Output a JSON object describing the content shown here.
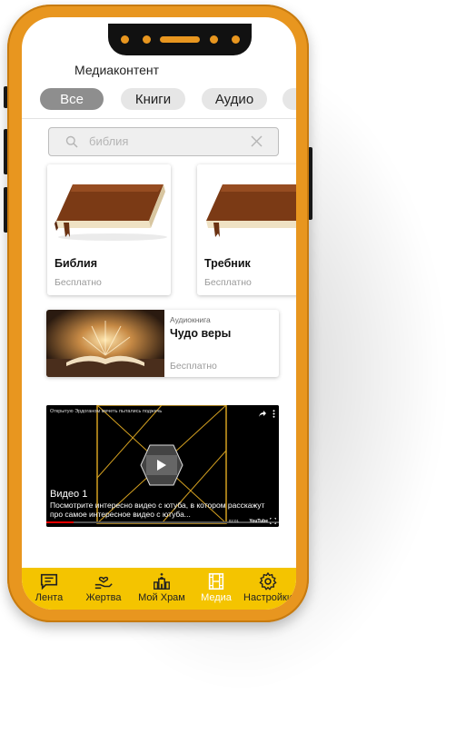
{
  "header": {
    "title": "Медиаконтент"
  },
  "filters": [
    {
      "label": "Все",
      "active": true
    },
    {
      "label": "Книги",
      "active": false
    },
    {
      "label": "Аудио",
      "active": false
    },
    {
      "label": "",
      "active": false
    }
  ],
  "search": {
    "value": "библия"
  },
  "books": [
    {
      "title": "Библия",
      "price": "Бесплатно"
    },
    {
      "title": "Требник",
      "price": "Бесплатно"
    }
  ],
  "audiobook": {
    "tag": "Аудиокнига",
    "title": "Чудо веры",
    "price": "Бесплатно"
  },
  "video": {
    "overlay_title": "Открытую Эрдоганом мечеть пытались поджечь",
    "label": "Видео 1",
    "description": "Посмотрите интересно видео с ютуба, в котором расскажут про самое интересное видео с ютуба...",
    "time": "02:01",
    "brand": "YouTube"
  },
  "tabbar": [
    {
      "label": "Лента",
      "icon": "chat-icon",
      "active": false
    },
    {
      "label": "Жертва",
      "icon": "donate-hand-icon",
      "active": false
    },
    {
      "label": "Мой Храм",
      "icon": "church-icon",
      "active": false
    },
    {
      "label": "Медиа",
      "icon": "film-icon",
      "active": true
    },
    {
      "label": "Настройки",
      "icon": "gear-icon",
      "active": false
    }
  ],
  "colors": {
    "frame": "#e8961f",
    "tabbar": "#f4c400",
    "pill_active": "#8e8e8e"
  }
}
